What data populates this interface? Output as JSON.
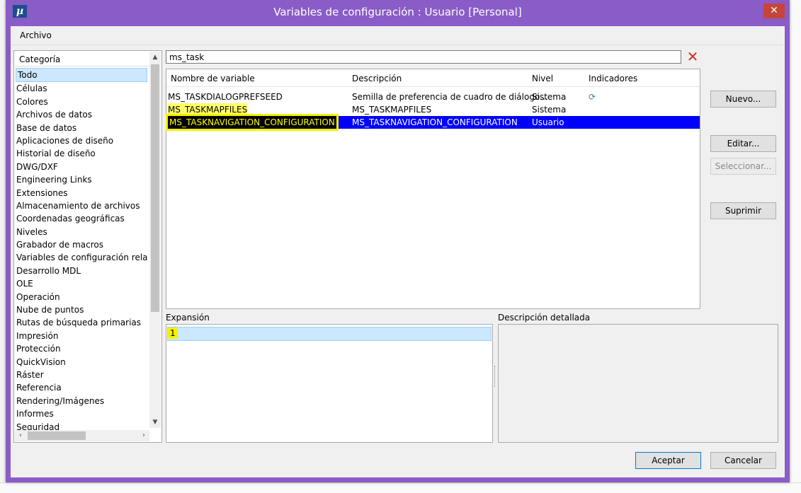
{
  "window": {
    "title": "Variables de configuración : Usuario [Personal]",
    "app_icon": "µ",
    "close": "✕"
  },
  "menu": {
    "archivo": "Archivo"
  },
  "categories": {
    "header": "Categoría",
    "items": [
      "Todo",
      "Células",
      "Colores",
      "Archivos de datos",
      "Base de datos",
      "Aplicaciones de diseño",
      "Historial de diseño",
      "DWG/DXF",
      "Engineering Links",
      "Extensiones",
      "Almacenamiento de archivos",
      "Coordenadas geográficas",
      "Niveles",
      "Grabador de macros",
      "Variables de configuración relac...",
      "Desarrollo MDL",
      "OLE",
      "Operación",
      "Nube de puntos",
      "Rutas de búsqueda primarias",
      "Impresión",
      "Protección",
      "QuickVision",
      "Ráster",
      "Referencia",
      "Rendering/Imágenes",
      "Informes",
      "Seguridad"
    ]
  },
  "search": {
    "value": "ms_task"
  },
  "table": {
    "headers": {
      "name": "Nombre de variable",
      "desc": "Descripción",
      "level": "Nivel",
      "flags": "Indicadores"
    },
    "rows": [
      {
        "name": "MS_TASKDIALOGPREFSEED",
        "desc": "Semilla de preferencia de cuadro de diálogo...",
        "level": "Sistema",
        "flag_icon": "lock-icon"
      },
      {
        "name": "MS_TASKMAPFILES",
        "desc": "MS_TASKMAPFILES",
        "level": "Sistema"
      },
      {
        "name": "MS_TASKNAVIGATION_CONFIGURATION",
        "desc": "MS_TASKNAVIGATION_CONFIGURATION",
        "level": "Usuario"
      }
    ]
  },
  "expansion": {
    "label": "Expansión",
    "value": "1"
  },
  "detail": {
    "label": "Descripción detallada"
  },
  "buttons": {
    "nuevo": "Nuevo...",
    "editar": "Editar...",
    "seleccionar": "Seleccionar...",
    "suprimir": "Suprimir",
    "aceptar": "Aceptar",
    "cancelar": "Cancelar"
  },
  "colors": {
    "titlebar": "#8a5cc7",
    "selection": "#0000ff",
    "highlight": "#ffff00",
    "clear": "#d52b1e"
  }
}
